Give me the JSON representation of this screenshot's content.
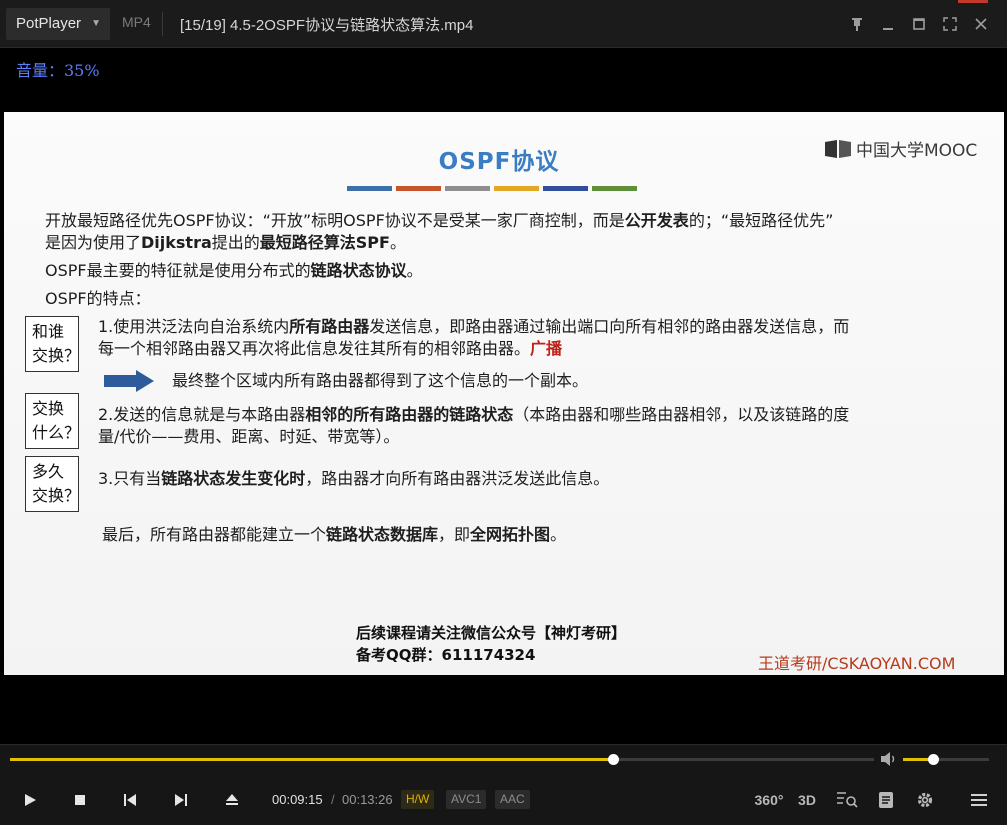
{
  "titlebar": {
    "app_name": "PotPlayer",
    "format": "MP4",
    "file_title": "[15/19] 4.5-2OSPF协议与链路状态算法.mp4"
  },
  "osd": {
    "volume_text": "音量：35%"
  },
  "slide": {
    "title": "OSPF协议",
    "logo_text": "中国大学MOOC",
    "bar_colors": [
      "#3d6fa8",
      "#c7552b",
      "#8e8e8e",
      "#e0a826",
      "#2f4f9c",
      "#5f8f3a"
    ],
    "intro": {
      "p1_a": "开放最短路径优先OSPF协议：“开放”标明OSPF协议不是受某一家厂商控制，而是",
      "p1_b": "公开发表",
      "p1_c": "的；“最短路径优先”",
      "p1_d": "是因为使用了",
      "p1_e": "Dijkstra",
      "p1_f": "提出的",
      "p1_g": "最短路径算法SPF",
      "p1_h": "。",
      "p2_a": "OSPF最主要的特征就是使用分布式的",
      "p2_b": "链路状态协议",
      "p2_c": "。",
      "p3": "OSPF的特点："
    },
    "box1": {
      "l1": "和谁",
      "l2": "交换？"
    },
    "box2": {
      "l1": "交换",
      "l2": "什么？"
    },
    "box3": {
      "l1": "多久",
      "l2": "交换？"
    },
    "point1": {
      "a": "1.使用洪泛法向自治系统内",
      "b": "所有路由器",
      "c": "发送信息，即路由器通过输出端口向所有相邻的路由器发送信息，而",
      "d": "每一个相邻路由器又再次将此信息发往其所有的相邻路由器。",
      "e": "广播"
    },
    "arrow_text": "最终整个区域内所有路由器都得到了这个信息的一个副本。",
    "point2": {
      "a": "2.发送的信息就是与本路由器",
      "b": "相邻的所有路由器的链路状态",
      "c": "（本路由器和哪些路由器相邻，以及该链路的度",
      "d": "量/代价——费用、距离、时延、带宽等）。"
    },
    "point3": {
      "a": "3.只有当",
      "b": "链路状态发生变化时",
      "c": "，路由器才向所有路由器洪泛发送此信息。"
    },
    "final": {
      "a": "最后，所有路由器都能建立一个",
      "b": "链路状态数据库",
      "c": "，即",
      "d": "全网拓扑图",
      "e": "。"
    },
    "follow_line1": "后续课程请关注微信公众号【神灯考研】",
    "follow_line2": "备考QQ群：611174324",
    "watermark": "王道考研/CSKAOYAN.COM"
  },
  "controls": {
    "seek_progress": 0.6977,
    "volume_level": 0.35,
    "time_current": "00:09:15",
    "time_separator": "/",
    "time_total": "00:13:26",
    "tags": [
      "H/W",
      "AVC1",
      "AAC"
    ],
    "vr_label": "360°",
    "three_d_label": "3D"
  }
}
